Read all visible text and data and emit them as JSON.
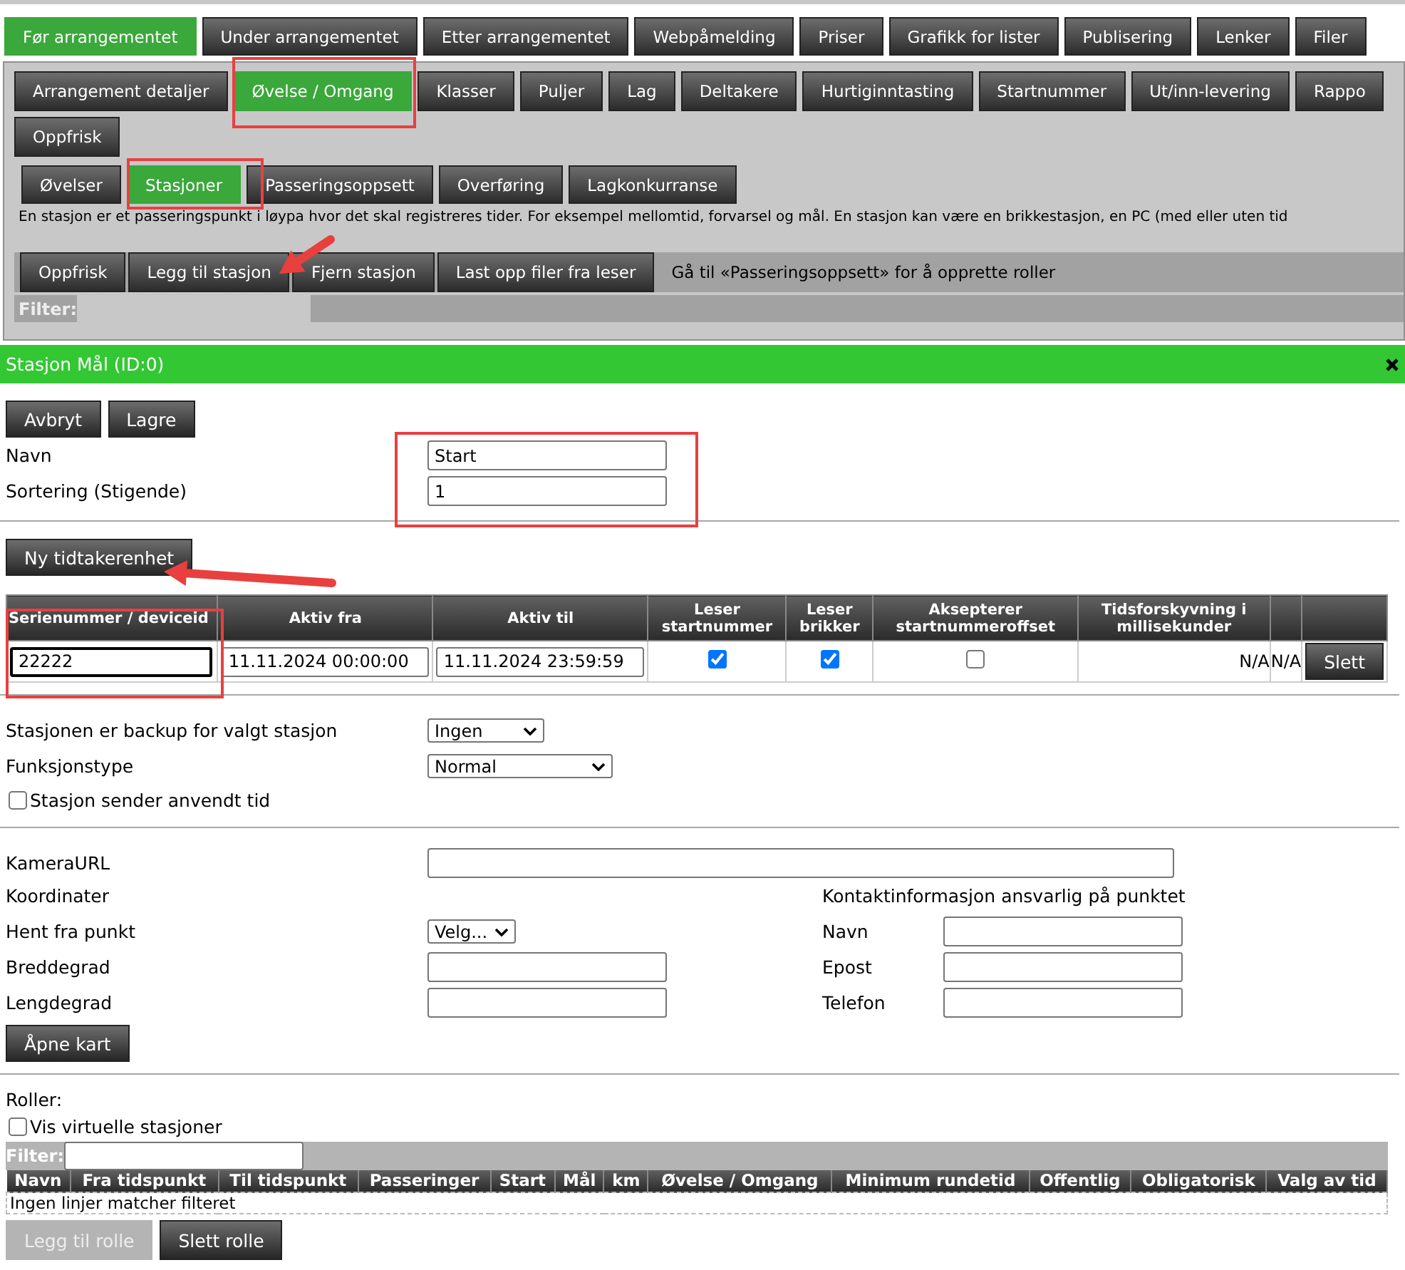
{
  "main_tabs": [
    {
      "label": "Før arrangementet",
      "selected": true
    },
    {
      "label": "Under arrangementet",
      "selected": false
    },
    {
      "label": "Etter arrangementet",
      "selected": false
    },
    {
      "label": "Webpåmelding",
      "selected": false
    },
    {
      "label": "Priser",
      "selected": false
    },
    {
      "label": "Grafikk for lister",
      "selected": false
    },
    {
      "label": "Publisering",
      "selected": false
    },
    {
      "label": "Lenker",
      "selected": false
    },
    {
      "label": "Filer",
      "selected": false
    }
  ],
  "section_tabs": [
    {
      "label": "Arrangement detaljer",
      "selected": false
    },
    {
      "label": "Øvelse / Omgang",
      "selected": true
    },
    {
      "label": "Klasser",
      "selected": false
    },
    {
      "label": "Puljer",
      "selected": false
    },
    {
      "label": "Lag",
      "selected": false
    },
    {
      "label": "Deltakere",
      "selected": false
    },
    {
      "label": "Hurtiginntasting",
      "selected": false
    },
    {
      "label": "Startnummer",
      "selected": false
    },
    {
      "label": "Ut/inn-levering",
      "selected": false
    },
    {
      "label": "Rappo",
      "selected": false
    }
  ],
  "refresh_tab": {
    "label": "Oppfrisk",
    "selected": false
  },
  "station_tabs": [
    {
      "label": "Øvelser",
      "selected": false
    },
    {
      "label": "Stasjoner",
      "selected": true
    },
    {
      "label": "Passeringsoppsett",
      "selected": false
    },
    {
      "label": "Overføring",
      "selected": false
    },
    {
      "label": "Lagkonkurranse",
      "selected": false
    }
  ],
  "description": "En stasjon er et passeringspunkt i løypa hvor det skal registreres tider. For eksempel mellomtid, forvarsel og mål. En stasjon kan være en brikkestasjon, en PC (med eller uten tid",
  "toolbar": {
    "buttons": [
      "Oppfrisk",
      "Legg til stasjon",
      "Fjern stasjon",
      "Last opp filer fra leser"
    ],
    "hint": "Gå til «Passeringsoppsett» for å opprette roller"
  },
  "list_filter": {
    "label": "Filter:"
  },
  "dialog": {
    "title": "Stasjon Mål (ID:0)",
    "buttons": [
      "Avbryt",
      "Lagre"
    ],
    "fields": [
      {
        "label": "Navn",
        "value": "Start"
      },
      {
        "label": "Sortering (Stigende)",
        "value": "1"
      }
    ],
    "new_unit_button": "Ny tidtakerenhet",
    "units_table": {
      "columns": [
        "Serienummer / deviceid",
        "Aktiv fra",
        "Aktiv til",
        "Leser startnummer",
        "Leser brikker",
        "Aksepterer startnummeroffset",
        "Tidsforskyvning i millisekunder"
      ],
      "rows": [
        {
          "serial": "22222",
          "from": "11.11.2024 00:00:00",
          "to": "11.11.2024 23:59:59",
          "reads_start_number": true,
          "reads_chips": true,
          "accepts_offset": false,
          "offset": "N/A",
          "column_8": "N/A",
          "delete_button": "Slett"
        }
      ]
    },
    "backup": {
      "label": "Stasjonen er backup for valgt stasjon",
      "value": "Ingen"
    },
    "function_type": {
      "label": "Funksjonstype",
      "value": "Normal"
    },
    "sends_applied_time": {
      "label": "Stasjon sender anvendt tid",
      "checked": false
    },
    "camera_url": {
      "label": "KameraURL"
    },
    "coordinates_label": "Koordinater",
    "contact_label": "Kontaktinformasjon ansvarlig på punktet",
    "fetch_point": {
      "label": "Hent fra punkt",
      "value": "Velg..."
    },
    "latitude": {
      "label": "Breddegrad"
    },
    "longitude": {
      "label": "Lengdegrad"
    },
    "contact_fields": [
      {
        "label": "Navn"
      },
      {
        "label": "Epost"
      },
      {
        "label": "Telefon"
      }
    ],
    "open_map_button": "Åpne kart",
    "roles": {
      "title": "Roller:",
      "show_virtual": {
        "label": "Vis virtuelle stasjoner",
        "checked": false
      },
      "filter_label": "Filter:",
      "columns": [
        "Navn",
        "Fra tidspunkt",
        "Til tidspunkt",
        "Passeringer",
        "Start",
        "Mål",
        "km",
        "Øvelse / Omgang",
        "Minimum rundetid",
        "Offentlig",
        "Obligatorisk",
        "Valg av tid"
      ],
      "empty_text": "Ingen linjer matcher filteret",
      "buttons": [
        {
          "label": "Legg til rolle",
          "disabled": true
        },
        {
          "label": "Slett rolle",
          "disabled": false
        }
      ]
    }
  },
  "annotations": [
    {
      "kind": "box"
    },
    {
      "kind": "box"
    },
    {
      "kind": "arrow"
    },
    {
      "kind": "box"
    },
    {
      "kind": "arrow"
    },
    {
      "kind": "box"
    }
  ]
}
